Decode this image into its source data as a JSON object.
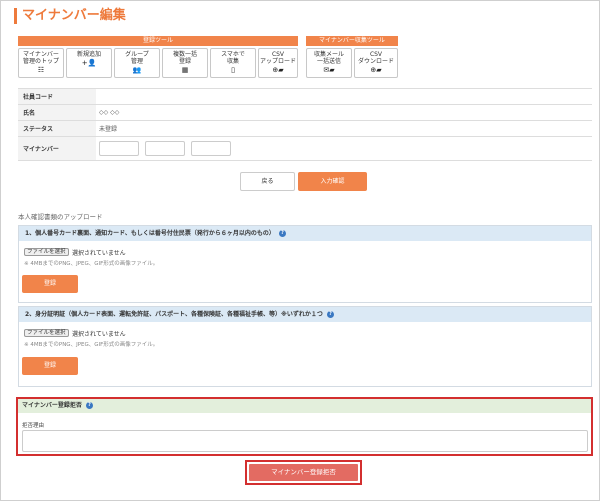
{
  "page_title": "マイナンバー編集",
  "toolbar": {
    "group1_label": "登録ツール",
    "group2_label": "マイナンバー収集ツール",
    "buttons": [
      {
        "label": "マイナンバー\n管理のトップ",
        "icon": "☷"
      },
      {
        "label": "新規追加",
        "icon": "+👤"
      },
      {
        "label": "グループ\n管理",
        "icon": "👥"
      },
      {
        "label": "複数一括\n登録",
        "icon": "▦"
      },
      {
        "label": "スマホで\n収集",
        "icon": "▯"
      },
      {
        "label": "CSV\nアップロード",
        "icon": "⊕▰"
      },
      {
        "label": "収集メール\n一括送信",
        "icon": "✉▰"
      },
      {
        "label": "CSV\nダウンロード",
        "icon": "⊕▰"
      }
    ]
  },
  "info": {
    "rows": [
      {
        "key": "社員コード",
        "value": ""
      },
      {
        "key": "氏名",
        "value": "◇◇ ◇◇"
      },
      {
        "key": "ステータス",
        "value": "未登録"
      },
      {
        "key": "マイナンバー",
        "value": ""
      }
    ]
  },
  "actions": {
    "back": "戻る",
    "confirm": "入力確認"
  },
  "upload": {
    "section_title": "本人確認書類のアップロード",
    "panels": [
      {
        "title": "1、個人番号カード裏面、通知カード、もしくは番号付住民票（発行から６ヶ月以内のもの）",
        "file_button": "ファイルを選択",
        "file_status": "選択されていません",
        "note": "※ 4MBまでのPNG、JPEG、GIF形式の画像ファイル。",
        "register": "登録"
      },
      {
        "title": "2、身分証明証（個人カード表面、運転免許証、パスポート、各種保険証、各種福祉手帳、等）※いずれか１つ",
        "file_button": "ファイルを選択",
        "file_status": "選択されていません",
        "note": "※ 4MBまでのPNG、JPEG、GIF形式の画像ファイル。",
        "register": "登録"
      }
    ],
    "help_mark": "?"
  },
  "reject": {
    "title": "マイナンバー登録拒否",
    "reason_label": "拒否理由",
    "reason_value": "",
    "button": "マイナンバー登録拒否"
  },
  "colors": {
    "accent": "#ee7a3c",
    "danger": "#d32f2f",
    "panel_head": "#dbe9f5"
  }
}
